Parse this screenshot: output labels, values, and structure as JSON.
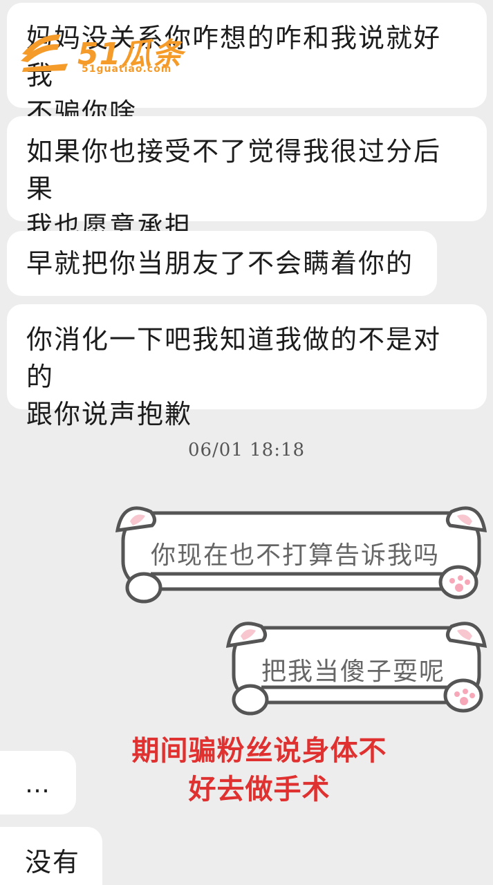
{
  "messages": {
    "m1": {
      "line1": "妈妈没关系你咋想的咋和我说就好我",
      "line2": "不骗你啥"
    },
    "m2": {
      "line1": "如果你也接受不了觉得我很过分后果",
      "line2": "我也愿意承担"
    },
    "m3": {
      "line1": "早就把你当朋友了不会瞒着你的"
    },
    "m4": {
      "line1": "你消化一下吧我知道我做的不是对的",
      "line2": "跟你说声抱歉"
    },
    "timestamp": "06/01  18:18",
    "m5": {
      "text": "你现在也不打算告诉我吗"
    },
    "m6": {
      "text": "把我当傻子耍呢"
    },
    "m7": {
      "text": "…"
    },
    "m8": {
      "text": "没有"
    }
  },
  "caption": {
    "line1": "期间骗粉丝说身体不",
    "line2": "好去做手术"
  },
  "watermark": {
    "brand": "51瓜条",
    "domain": "51guatiao.com"
  },
  "colors": {
    "background": "#ededed",
    "caption": "#e03131",
    "watermark": "#f49b2a",
    "cat_ear": "#f7c6cf"
  }
}
